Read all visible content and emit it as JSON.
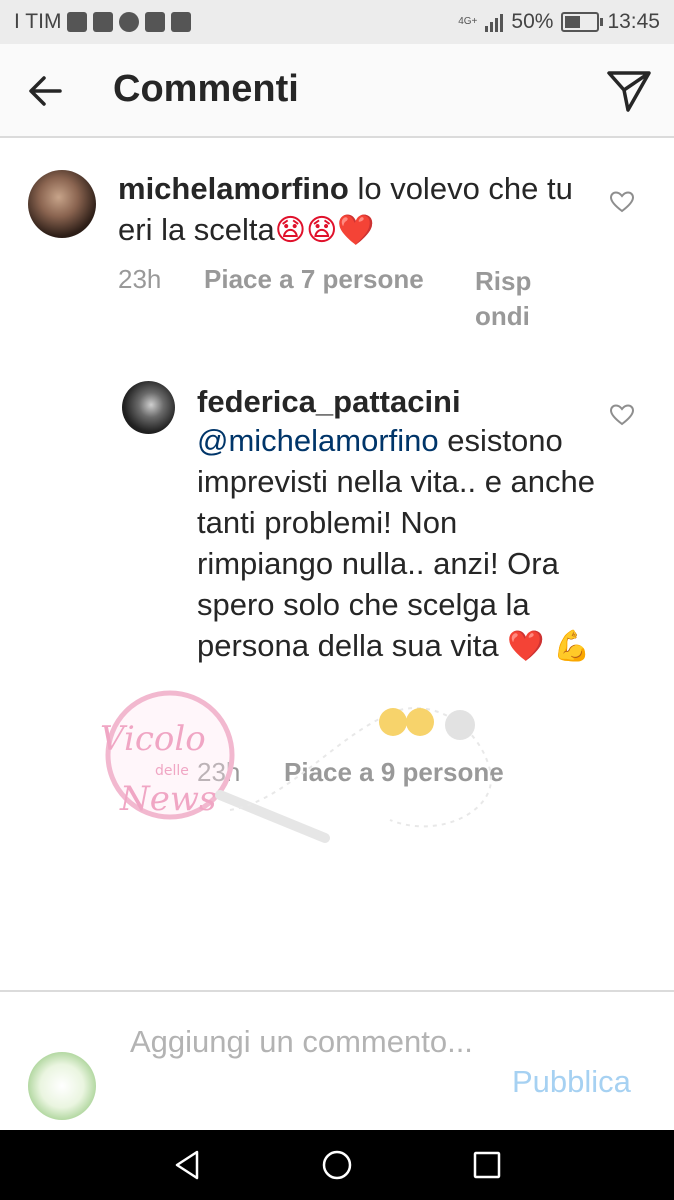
{
  "status_bar": {
    "carrier": "I TIM",
    "network": "4G+",
    "battery": "50%",
    "battery_level": 0.5,
    "time": "13:45"
  },
  "header": {
    "title": "Commenti",
    "back_icon": "arrow-left-icon",
    "send_icon": "paper-plane-icon"
  },
  "comments": [
    {
      "username": "michelamorfino",
      "text": "lo volevo che tu eri la scelta",
      "emojis": "😧😧❤️",
      "time": "23h",
      "likes": "Piace a 7 persone",
      "reply": "Risp ondi"
    },
    {
      "username": "federica_pattacini",
      "mention": "@michelamorfino",
      "text": "esistono imprevisti nella vita.. e anche tanti problemi! Non rimpiango nulla.. anzi! Ora spero solo che scelga la persona della sua vita",
      "emojis": "❤️",
      "trailing_emoji": "💪",
      "time": "23h",
      "likes": "Piace a 9 persone"
    }
  ],
  "watermark": {
    "line1": "Vicolo",
    "line2": "delle",
    "line3": "News"
  },
  "input": {
    "placeholder": "Aggiungi un commento...",
    "publish": "Pubblica"
  },
  "colors": {
    "mention": "#003569",
    "meta": "#999999",
    "publish_disabled": "#a6d1f2",
    "heart": "#e0112b"
  }
}
